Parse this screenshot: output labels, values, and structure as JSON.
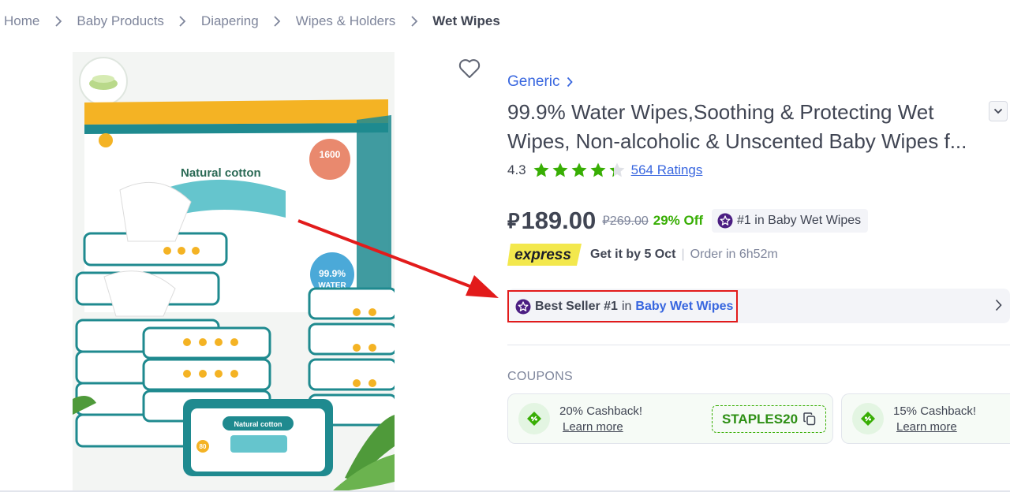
{
  "breadcrumb": [
    "Home",
    "Baby Products",
    "Diapering",
    "Wipes & Holders",
    "Wet Wipes"
  ],
  "product": {
    "brand": "Generic",
    "title": "99.9% Water Wipes,Soothing & Protecting Wet Wipes, Non-alcoholic & Unscented Baby Wipes f...",
    "rating": "4.3",
    "rating_value": 4.3,
    "ratings_count": "564 Ratings",
    "price": "189.00",
    "old_price": "269.00",
    "discount": "29% Off",
    "rank_badge": "#1 in Baby Wet Wipes",
    "express_label": "express",
    "delivery": "Get it by 5 Oct",
    "order_in": "Order in 6h52m",
    "bestseller": {
      "label": "Best Seller #1",
      "in": "in",
      "category": "Baby Wet Wipes"
    }
  },
  "image": {
    "box_text_top": "Natural cotton",
    "box_badge": "1600",
    "water_badge_pct": "99.9%",
    "water_badge_word": "WATER",
    "pack_label": "Natural cotton",
    "count_badge": "80"
  },
  "coupons": {
    "heading": "COUPONS",
    "items": [
      {
        "title": "20% Cashback!",
        "link": "Learn more",
        "code": "STAPLES20"
      },
      {
        "title": "15% Cashback!",
        "link": "Learn more"
      }
    ]
  },
  "colors": {
    "link_blue": "#3866df",
    "discount_green": "#38ae04",
    "star_green": "#38ae04",
    "express_yellow": "#f3e84d",
    "annotation_red": "#e21b1b",
    "badge_purple": "#4b1e82"
  },
  "icons": [
    "chevron-right-icon",
    "heart-icon",
    "chevron-down-icon",
    "star-icon",
    "purple-star-badge-icon",
    "copy-icon",
    "coupon-tag-icon"
  ]
}
